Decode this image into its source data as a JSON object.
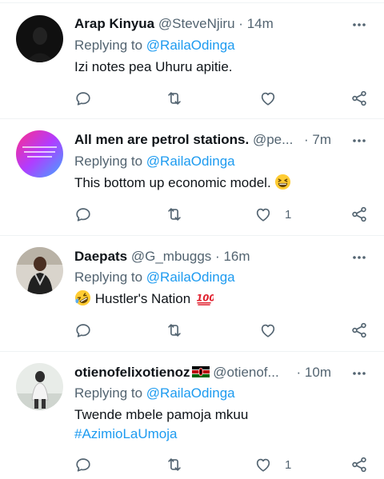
{
  "tweets": [
    {
      "name": "Arap Kinyua",
      "handle": "@SteveNjiru",
      "separator": "·",
      "time": "14m",
      "replying_prefix": "Replying to",
      "replying_to": "@RailaOdinga",
      "text": "Izi notes pea Uhuru apitie.",
      "likes": ""
    },
    {
      "name": "All men are petrol stations.",
      "handle": "@pe...",
      "separator": "·",
      "time": "7m",
      "replying_prefix": "Replying to",
      "replying_to": "@RailaOdinga",
      "text": "This bottom up economic model.",
      "emoji": "grinning-squinting-face",
      "likes": "1"
    },
    {
      "name": "Daepats",
      "handle": "@G_mbuggs",
      "separator": "·",
      "time": "16m",
      "replying_prefix": "Replying to",
      "replying_to": "@RailaOdinga",
      "text": "Hustler's Nation",
      "emoji_before": "rolling-on-floor-laughing",
      "emoji_after": "hundred-points",
      "likes": ""
    },
    {
      "name": "otienofelixotienoz",
      "name_flag": "kenya-flag",
      "handle": "@otienof...",
      "separator": "·",
      "time": "10m",
      "replying_prefix": "Replying to",
      "replying_to": "@RailaOdinga",
      "text": "Twende mbele pamoja mkuu",
      "hashtag": "#AzimioLaUmoja",
      "likes": "1"
    }
  ],
  "icons": {
    "reply": "reply-icon",
    "retweet": "retweet-icon",
    "like": "heart-icon",
    "share": "share-icon",
    "more": "more-options-icon"
  },
  "colors": {
    "link": "#1d9bf0",
    "secondary": "#536471",
    "text": "#0f1419"
  }
}
